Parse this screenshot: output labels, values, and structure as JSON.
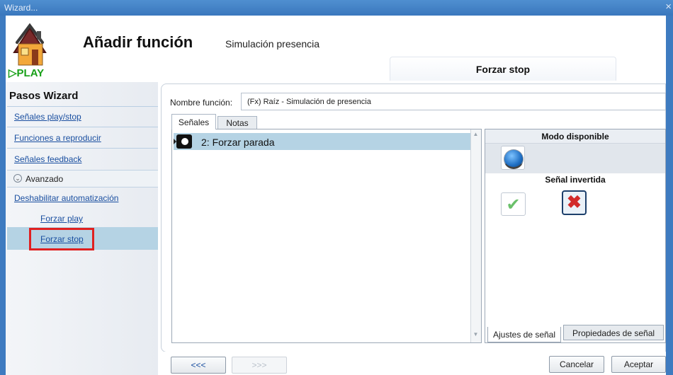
{
  "window": {
    "title": "Wizard...",
    "close_glyph": "×"
  },
  "header": {
    "title": "Añadir función",
    "subtitle": "Simulación presencia",
    "logo_text": "PLAY",
    "active_step_tab": "Forzar stop"
  },
  "sidebar": {
    "title": "Pasos Wizard",
    "items": [
      {
        "label": "Señales play/stop"
      },
      {
        "label": "Funciones a reproducir"
      },
      {
        "label": "Señales feedback"
      }
    ],
    "advanced": {
      "label": "Avanzado",
      "expand_glyph": "⌄"
    },
    "advanced_items": [
      {
        "label": "Deshabilitar automatización"
      },
      {
        "label": "Forzar play"
      },
      {
        "label": "Forzar stop"
      }
    ]
  },
  "form": {
    "name_label": "Nombre función:",
    "name_value": "(Fx) Raíz - Simulación de presencia"
  },
  "tabs": [
    {
      "label": "Señales"
    },
    {
      "label": "Notas"
    }
  ],
  "signal_list": [
    {
      "label": "2: Forzar parada"
    }
  ],
  "settings": {
    "mode_header": "Modo disponible",
    "inverted_header": "Señal invertida",
    "bottom_tabs": [
      {
        "label": "Ajustes de señal"
      },
      {
        "label": "Propiedades de señal"
      }
    ]
  },
  "buttons": {
    "prev": "<<<",
    "next": ">>>",
    "cancel": "Cancelar",
    "accept": "Aceptar"
  },
  "colors": {
    "accent_blue": "#3e7bc0",
    "selection": "#b5d3e4",
    "highlight_border": "#e02020"
  }
}
